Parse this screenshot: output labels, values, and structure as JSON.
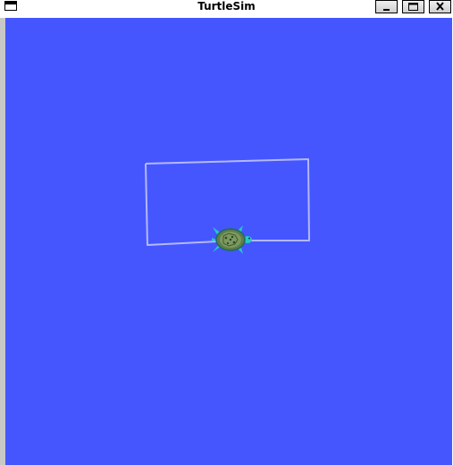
{
  "window": {
    "title": "TurtleSim",
    "background_color": "#4556ff",
    "pen_color": "#b3b8ff"
  },
  "titlebar_buttons": {
    "minimize_icon": "minimize-icon",
    "maximize_icon": "maximize-icon",
    "close_icon": "close-icon"
  },
  "turtle": {
    "icon": "turtle-icon",
    "shell_color": "#6c8a54",
    "limb_color": "#27c7c7"
  }
}
